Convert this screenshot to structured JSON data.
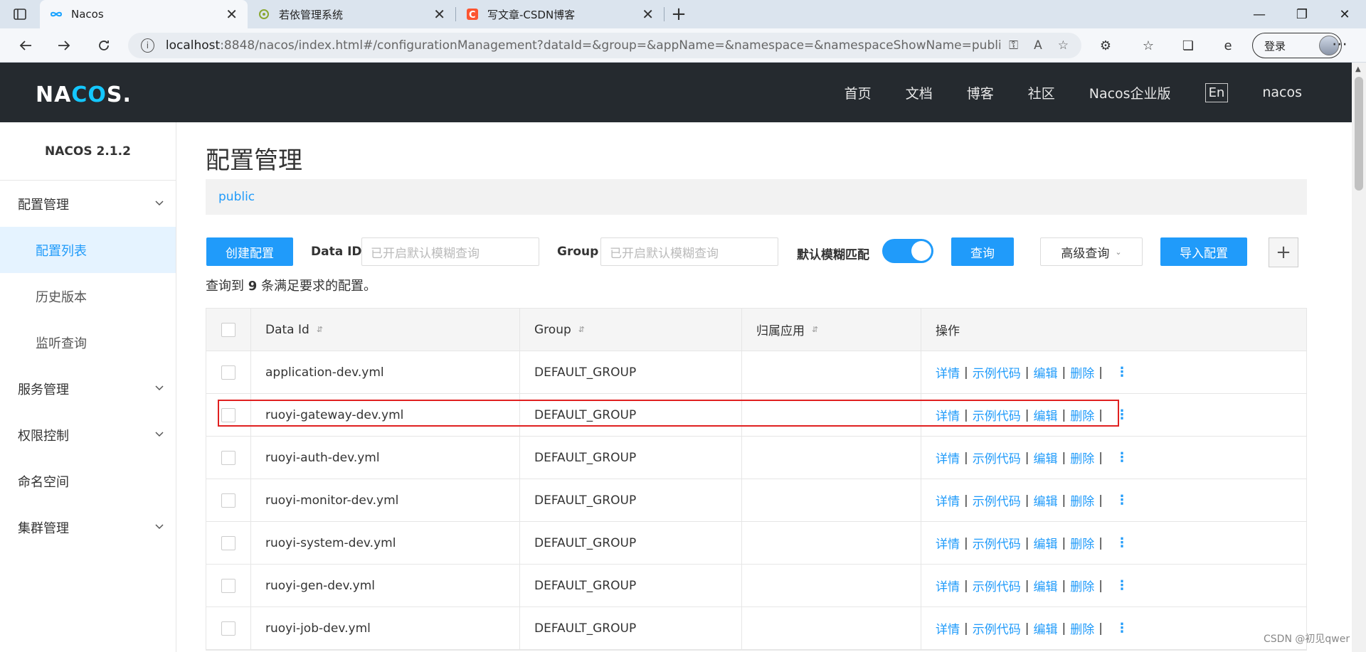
{
  "browser": {
    "tabs": [
      {
        "title": "Nacos",
        "active": true
      },
      {
        "title": "若依管理系统",
        "active": false
      },
      {
        "title": "写文章-CSDN博客",
        "active": false
      }
    ],
    "url_host": "localhost",
    "url_rest": ":8848/nacos/index.html#/configurationManagement?dataId=&group=&appName=&namespace=&namespaceShowName=public&pag...",
    "login_label": "登录"
  },
  "app": {
    "logo_left": "NA",
    "logo_mid": "CO",
    "logo_right": "S.",
    "nav": [
      "首页",
      "文档",
      "博客",
      "社区",
      "Nacos企业版"
    ],
    "lang": "En",
    "user": "nacos"
  },
  "sidebar": {
    "version": "NACOS 2.1.2",
    "items": [
      {
        "label": "配置管理",
        "expandable": true
      },
      {
        "label": "配置列表",
        "sub": true,
        "active": true
      },
      {
        "label": "历史版本",
        "sub": true
      },
      {
        "label": "监听查询",
        "sub": true
      },
      {
        "label": "服务管理",
        "expandable": true
      },
      {
        "label": "权限控制",
        "expandable": true
      },
      {
        "label": "命名空间"
      },
      {
        "label": "集群管理",
        "expandable": true
      }
    ]
  },
  "main": {
    "title": "配置管理",
    "namespace": "public",
    "create_btn": "创建配置",
    "dataid_label": "Data ID",
    "dataid_placeholder": "已开启默认模糊查询",
    "group_label": "Group",
    "group_placeholder": "已开启默认模糊查询",
    "fuzzy_label": "默认模糊匹配",
    "fuzzy_on": true,
    "query_btn": "查询",
    "advanced_btn": "高级查询",
    "import_btn": "导入配置",
    "plus_btn": "+",
    "result_prefix": "查询到",
    "result_count": "9",
    "result_suffix": "条满足要求的配置。"
  },
  "table": {
    "headers": [
      "Data Id",
      "Group",
      "归属应用",
      "操作"
    ],
    "ops": [
      "详情",
      "示例代码",
      "编辑",
      "删除"
    ],
    "rows": [
      {
        "data_id": "application-dev.yml",
        "group": "DEFAULT_GROUP",
        "app": ""
      },
      {
        "data_id": "ruoyi-gateway-dev.yml",
        "group": "DEFAULT_GROUP",
        "app": "",
        "highlighted": true
      },
      {
        "data_id": "ruoyi-auth-dev.yml",
        "group": "DEFAULT_GROUP",
        "app": ""
      },
      {
        "data_id": "ruoyi-monitor-dev.yml",
        "group": "DEFAULT_GROUP",
        "app": ""
      },
      {
        "data_id": "ruoyi-system-dev.yml",
        "group": "DEFAULT_GROUP",
        "app": ""
      },
      {
        "data_id": "ruoyi-gen-dev.yml",
        "group": "DEFAULT_GROUP",
        "app": ""
      },
      {
        "data_id": "ruoyi-job-dev.yml",
        "group": "DEFAULT_GROUP",
        "app": ""
      }
    ]
  },
  "watermark": "CSDN @初见qwer",
  "colors": {
    "accent": "#209bfa",
    "header_bg": "#252a2f",
    "highlight": "#e02020"
  }
}
